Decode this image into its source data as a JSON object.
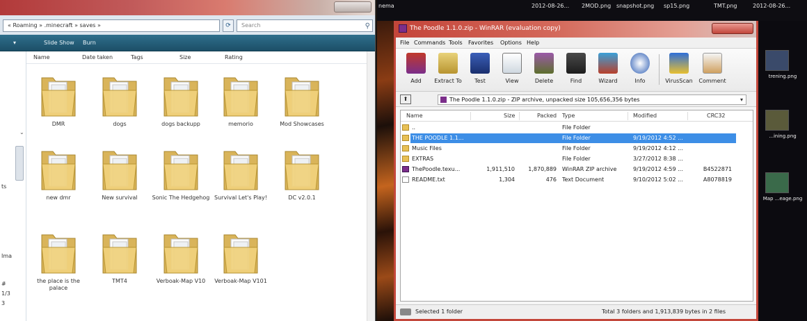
{
  "explorer": {
    "address": "« Roaming » .minecraft » saves »",
    "search_placeholder": "Search",
    "toolbar": [
      "Slide Show",
      "Burn"
    ],
    "columns": [
      "Name",
      "Date taken",
      "Tags",
      "Size",
      "Rating"
    ],
    "folders": [
      "DMR",
      "dogs",
      "dogs backupp",
      "memorio",
      "Mod Showcases",
      "new dmr",
      "New survival",
      "Sonic The Hedgehog",
      "Survival Let's Play!",
      "DC v2.0.1",
      "the place is the palace",
      "TMT4",
      "Verboak-Map V10",
      "Verboak-Map V101"
    ],
    "nav_labels": [
      "ts",
      "Ima",
      "#",
      "1/3",
      "3"
    ]
  },
  "desktop": {
    "top_labels": [
      "2012-08-26...",
      "2MOD.png",
      "snapshot.png",
      "sp15.png",
      "TMT.png",
      "2012-08-26..."
    ],
    "top_left_label": "nema",
    "right_labels": [
      "trening.png",
      "...ining.png",
      "Map ...eage.png"
    ]
  },
  "winrar": {
    "title": "The Poodle 1.1.0.zip - WinRAR (evaluation copy)",
    "menu": [
      "File",
      "Commands",
      "Tools",
      "Favorites",
      "Options",
      "Help"
    ],
    "tools": [
      "Add",
      "Extract To",
      "Test",
      "View",
      "Delete",
      "Find",
      "Wizard",
      "Info",
      "VirusScan",
      "Comment"
    ],
    "path": "The Poodle 1.1.0.zip - ZIP archive, unpacked size 105,656,356 bytes",
    "columns": [
      "Name",
      "Size",
      "Packed",
      "Type",
      "Modified",
      "CRC32"
    ],
    "rows": [
      {
        "name": "..",
        "size": "",
        "packed": "",
        "type": "File Folder",
        "modified": "",
        "crc": "",
        "icon": "folder",
        "selected": false
      },
      {
        "name": "THE POODLE 1.1...",
        "size": "",
        "packed": "",
        "type": "File Folder",
        "modified": "9/19/2012 4:52 ...",
        "crc": "",
        "icon": "folder",
        "selected": true
      },
      {
        "name": "Music Files",
        "size": "",
        "packed": "",
        "type": "File Folder",
        "modified": "9/19/2012 4:12 ...",
        "crc": "",
        "icon": "folder",
        "selected": false
      },
      {
        "name": "EXTRAS",
        "size": "",
        "packed": "",
        "type": "File Folder",
        "modified": "3/27/2012 8:38 ...",
        "crc": "",
        "icon": "folder",
        "selected": false
      },
      {
        "name": "ThePoodle.texu...",
        "size": "1,911,510",
        "packed": "1,870,889",
        "type": "WinRAR ZIP archive",
        "modified": "9/19/2012 4:59 ...",
        "crc": "B4522871",
        "icon": "rar",
        "selected": false
      },
      {
        "name": "README.txt",
        "size": "1,304",
        "packed": "476",
        "type": "Text Document",
        "modified": "9/10/2012 5:02 ...",
        "crc": "A8078819",
        "icon": "txt",
        "selected": false
      }
    ],
    "status_left": "Selected 1 folder",
    "status_right": "Total 3 folders and 1,913,839 bytes in 2 files"
  }
}
